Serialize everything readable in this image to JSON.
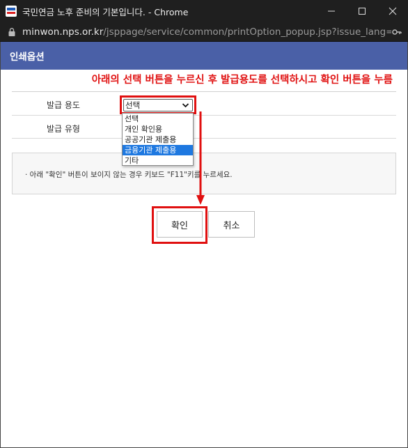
{
  "window": {
    "title": "국민연금 노후 준비의 기본입니다. - Chrome",
    "favicon": "nps-logo-icon"
  },
  "address": {
    "host": "minwon.nps.or.kr",
    "path": "/jsppage/service/common/printOption_popup.jsp?issue_lang=..."
  },
  "header": {
    "title": "인쇄옵션"
  },
  "notice": "아래의 선택 버튼을 누르신 후 발급용도를 선택하시고 확인 버튼을 누름",
  "form": {
    "rows": [
      {
        "label": "발급 용도"
      },
      {
        "label": "발급 유형"
      }
    ],
    "select_value": "선택",
    "options": [
      "선택",
      "개인 확인용",
      "공공기관 제출용",
      "금융기관 제출용",
      "기타"
    ],
    "selected_index": 3
  },
  "info": {
    "text": "· 아래 \"확인\" 버튼이 보이지 않는 경우 키보드 \"F11\"키를 누르세요."
  },
  "buttons": {
    "ok": "확인",
    "cancel": "취소"
  },
  "colors": {
    "header": "#4a60a7",
    "highlight": "#e01010",
    "selected": "#1e78e0"
  }
}
